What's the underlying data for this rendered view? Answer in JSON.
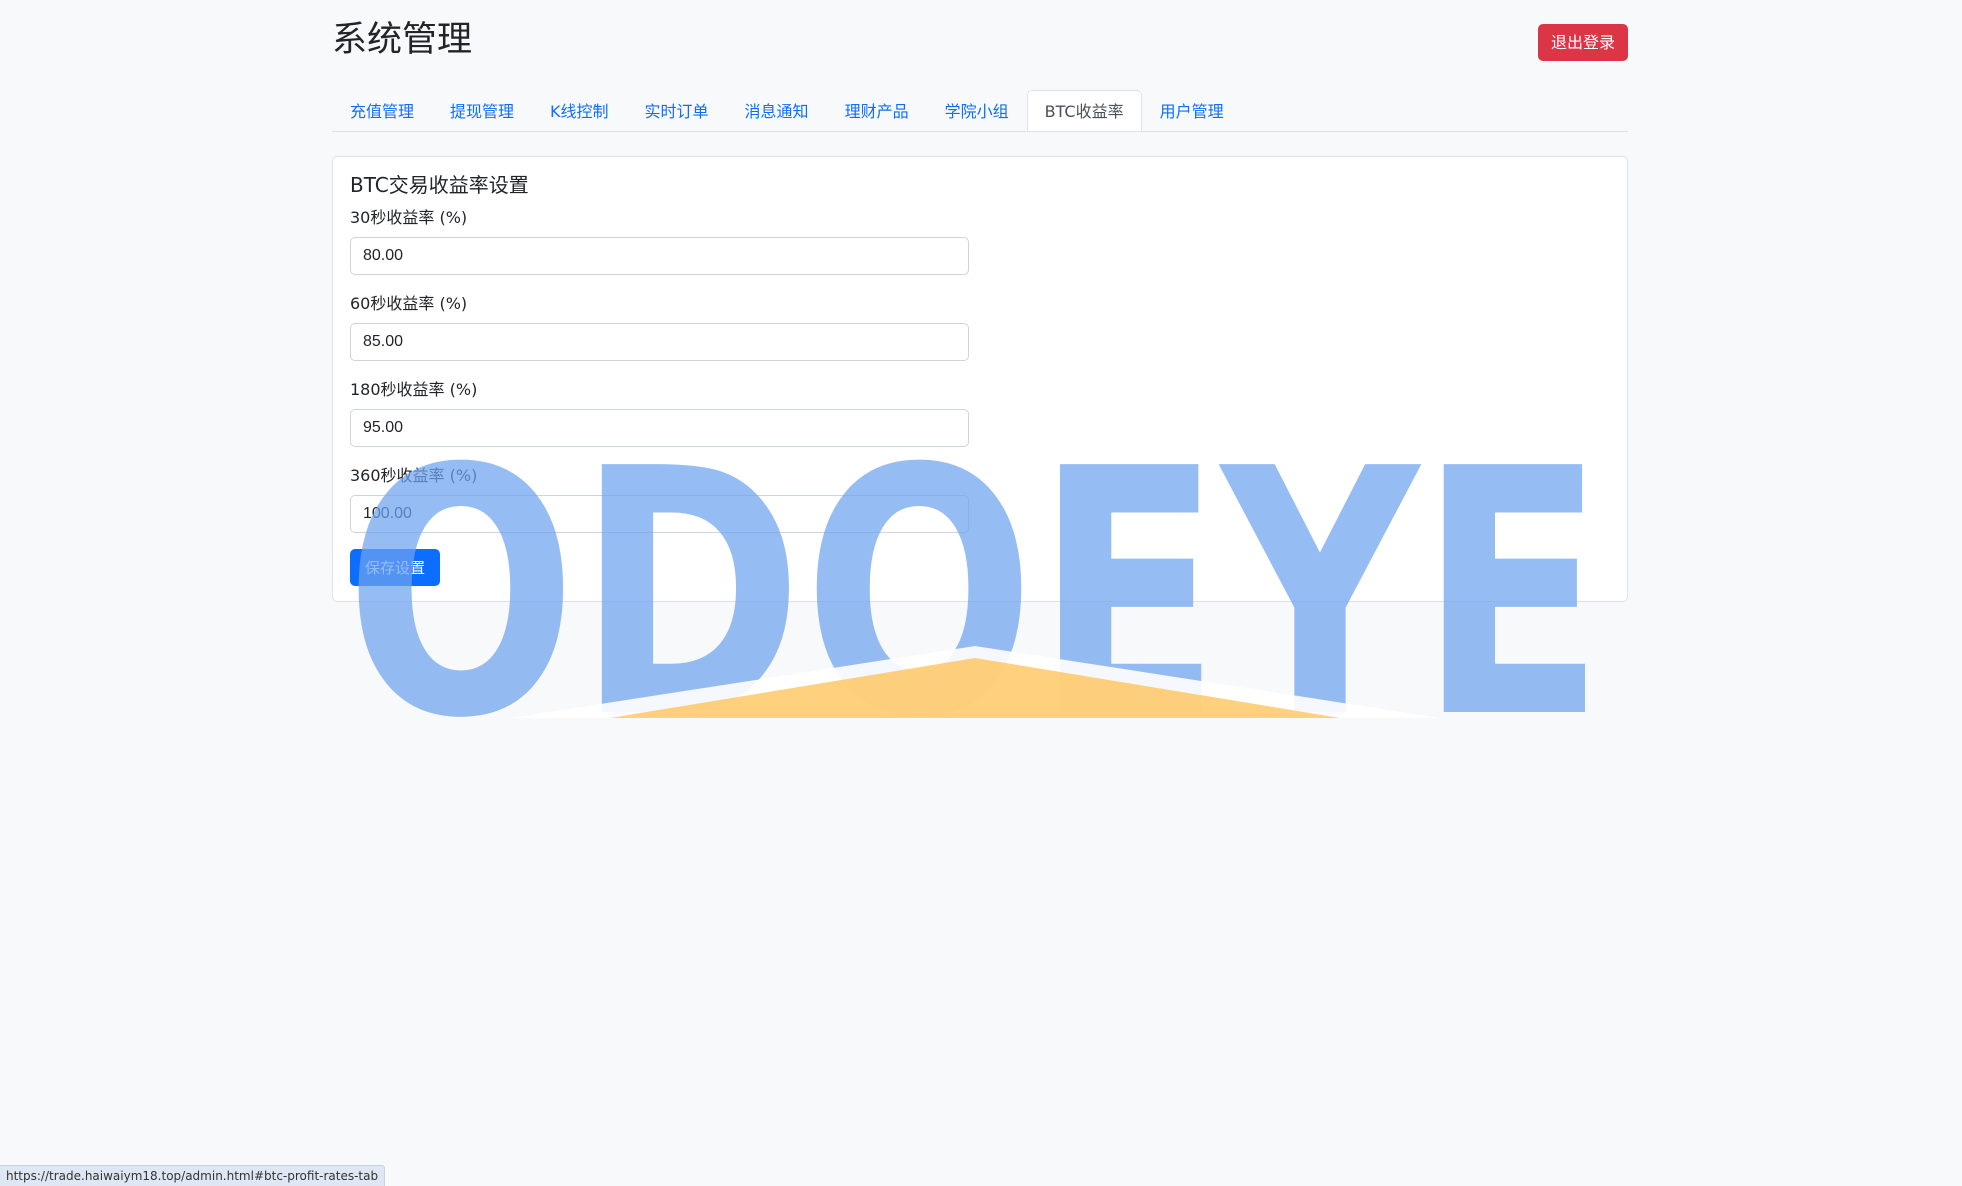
{
  "header": {
    "title": "系统管理",
    "logout_label": "退出登录"
  },
  "tabs": [
    {
      "label": "充值管理",
      "active": false
    },
    {
      "label": "提现管理",
      "active": false
    },
    {
      "label": "K线控制",
      "active": false
    },
    {
      "label": "实时订单",
      "active": false
    },
    {
      "label": "消息通知",
      "active": false
    },
    {
      "label": "理财产品",
      "active": false
    },
    {
      "label": "学院小组",
      "active": false
    },
    {
      "label": "BTC收益率",
      "active": true
    },
    {
      "label": "用户管理",
      "active": false
    }
  ],
  "card": {
    "title": "BTC交易收益率设置",
    "fields": [
      {
        "label": "30秒收益率 (%)",
        "value": "80.00"
      },
      {
        "label": "60秒收益率 (%)",
        "value": "85.00"
      },
      {
        "label": "180秒收益率 (%)",
        "value": "95.00"
      },
      {
        "label": "360秒收益率 (%)",
        "value": "100.00"
      }
    ],
    "save_label": "保存设置"
  },
  "watermark": {
    "text": "ODOEYE",
    "text_color": "#6fa3f0",
    "roof_color": "#ffc45c"
  },
  "status_bar": {
    "url": "https://trade.haiwaiym18.top/admin.html#btc-profit-rates-tab"
  },
  "colors": {
    "primary": "#0d6efd",
    "danger": "#dc3545",
    "background": "#f8f9fa"
  }
}
